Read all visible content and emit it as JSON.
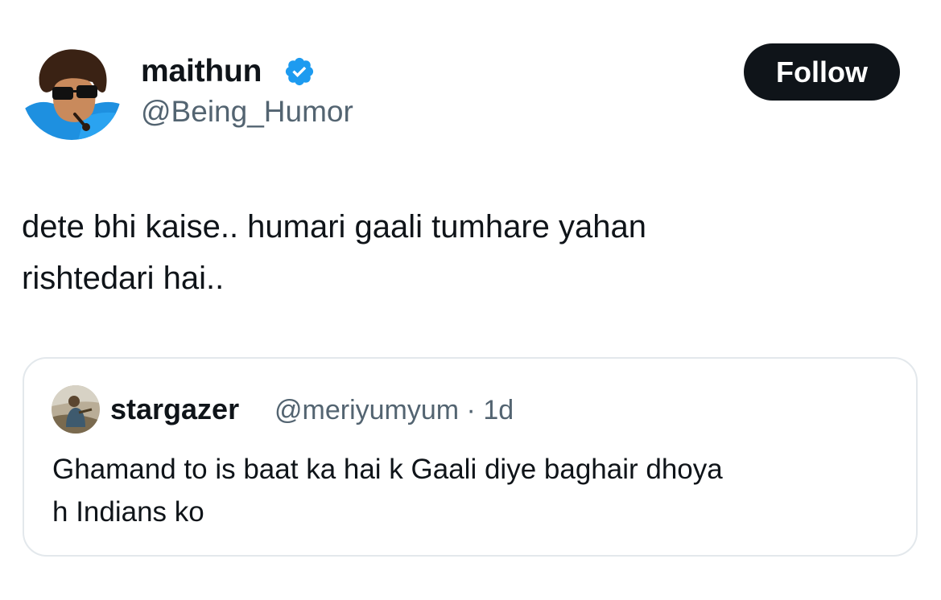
{
  "author": {
    "name": "maithun",
    "handle": "@Being_Humor",
    "verified_icon": "verified-badge-icon",
    "avatar_description": "profile-avatar"
  },
  "follow_button": {
    "label": "Follow"
  },
  "tweet": {
    "text_lines": [
      "dete bhi kaise.. humari gaali tumhare yahan",
      "rishtedari hai.."
    ]
  },
  "quoted_tweet": {
    "author_name": "stargazer",
    "author_handle": "@meriyumyum",
    "separator": "·",
    "time": "1d",
    "text_lines": [
      "Ghamand to is baat ka hai k Gaali diye baghair dhoya",
      "h Indians ko"
    ]
  },
  "colors": {
    "text_primary": "#0f1419",
    "text_secondary": "#536471",
    "verified_blue": "#1d9bf0",
    "button_bg": "#0f1419",
    "border": "#e3e8ec"
  }
}
